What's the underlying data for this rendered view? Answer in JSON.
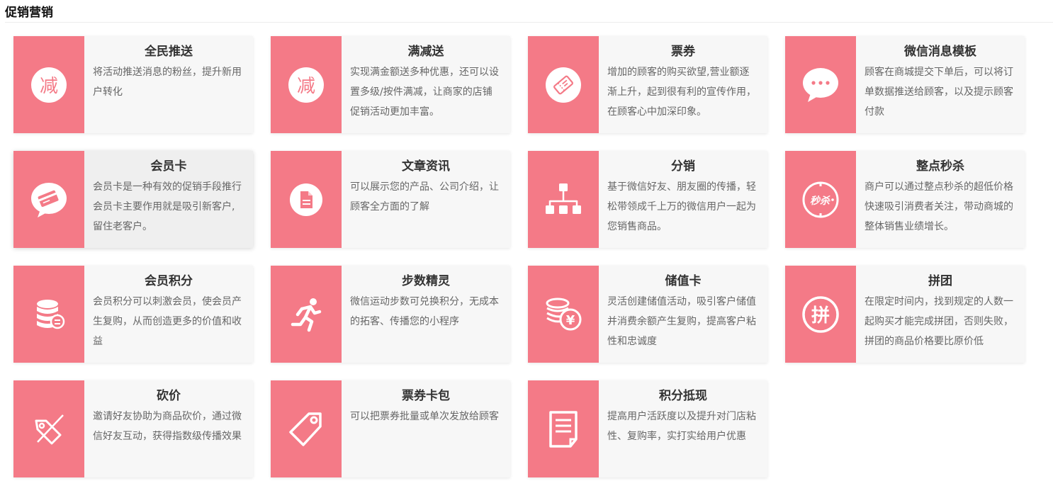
{
  "section": {
    "title": "促销营销"
  },
  "colors": {
    "accent": "#f47a87",
    "card_bg": "#f7f7f7"
  },
  "cards": [
    {
      "title": "全民推送",
      "icon": "jian-badge-icon",
      "glyph": "减",
      "desc": "将活动推送消息的粉丝，提升新用户转化"
    },
    {
      "title": "满减送",
      "icon": "jian-badge-icon",
      "glyph": "减",
      "desc": "实现满金额送多种优惠，还可以设置多级/按件满减，让商家的店铺促销活动更加丰富。"
    },
    {
      "title": "票券",
      "icon": "ticket-icon",
      "desc": "增加的顾客的购买欲望,营业额逐渐上升，起到很有利的宣传作用，在顾客心中加深印象。"
    },
    {
      "title": "微信消息模板",
      "icon": "chat-bubble-icon",
      "desc": "顾客在商城提交下单后，可以将订单数据推送给顾客，以及提示顾客付款"
    },
    {
      "title": "会员卡",
      "icon": "member-card-icon",
      "desc": "会员卡是一种有效的促销手段推行会员卡主要作用就是吸引新客户,留住老客户。"
    },
    {
      "title": "文章资讯",
      "icon": "document-icon",
      "desc": "可以展示您的产品、公司介绍，让顾客全方面的了解"
    },
    {
      "title": "分销",
      "icon": "hierarchy-icon",
      "desc": "基于微信好友、朋友圈的传播，轻松带领成千上万的微信用户一起为您销售商品。"
    },
    {
      "title": "整点秒杀",
      "icon": "flash-sale-icon",
      "glyph": "秒杀",
      "desc": "商户可以通过整点秒杀的超低价格快速吸引消费者关注，带动商城的整体销售业绩增长。"
    },
    {
      "title": "会员积分",
      "icon": "database-icon",
      "desc": "会员积分可以刺激会员，使会员产生复购，从而创造更多的价值和收益"
    },
    {
      "title": "步数精灵",
      "icon": "runner-icon",
      "desc": "微信运动步数可兑换积分，无成本的拓客、传播您的小程序"
    },
    {
      "title": "储值卡",
      "icon": "coins-yen-icon",
      "glyph": "¥",
      "desc": "灵活创建储值活动，吸引客户储值并消费余额产生复购，提高客户粘性和忠诚度"
    },
    {
      "title": "拼团",
      "icon": "pin-badge-icon",
      "glyph": "拼",
      "desc": "在限定时间内，找到规定的人数一起购买才能完成拼团，否则失败，拼团的商品价格要比原价低"
    },
    {
      "title": "砍价",
      "icon": "cut-price-tag-icon",
      "desc": "邀请好友协助为商品砍价，通过微信好友互动，获得指数级传播效果"
    },
    {
      "title": "票券卡包",
      "icon": "tag-icon",
      "desc": "可以把票券批量或单次发放给顾客"
    },
    {
      "title": "积分抵现",
      "icon": "receipt-icon",
      "desc": "提高用户活跃度以及提升对门店粘性、复购率，实打实给用户优惠"
    }
  ]
}
